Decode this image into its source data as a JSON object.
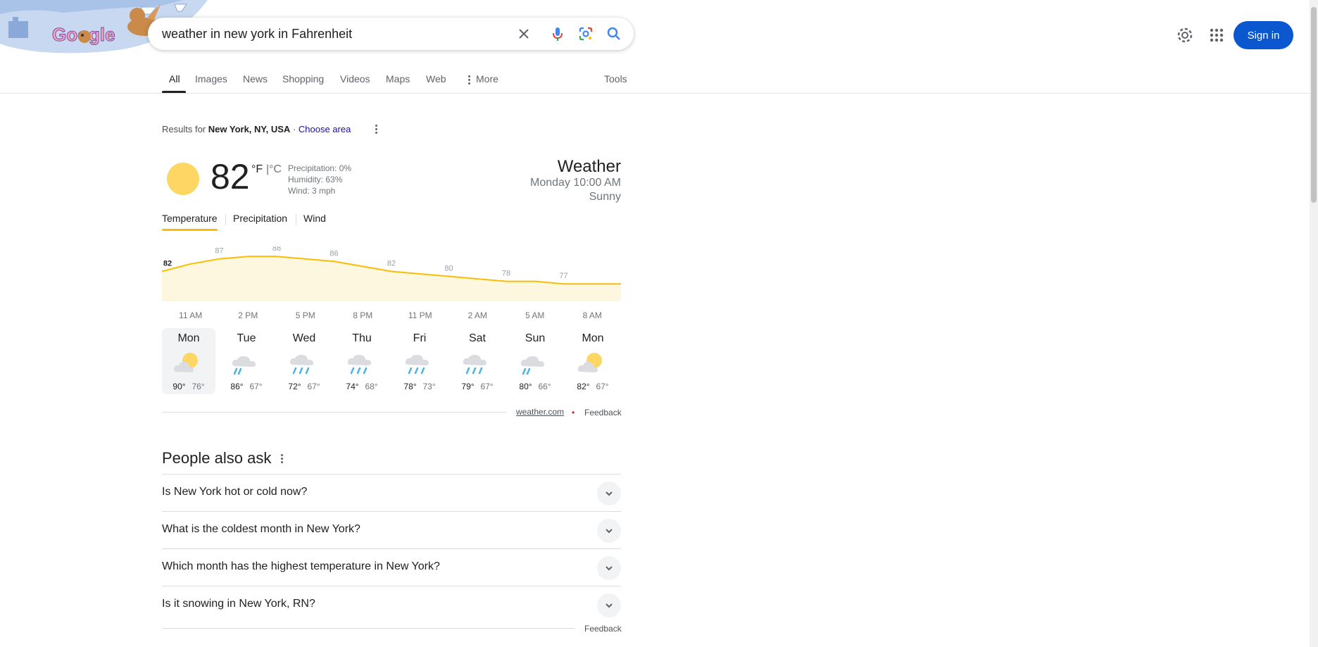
{
  "search": {
    "query": "weather in new york in Fahrenheit"
  },
  "header": {
    "sign_in": "Sign in"
  },
  "tabs": [
    {
      "label": "All"
    },
    {
      "label": "Images"
    },
    {
      "label": "News"
    },
    {
      "label": "Shopping"
    },
    {
      "label": "Videos"
    },
    {
      "label": "Maps"
    },
    {
      "label": "Web"
    },
    {
      "label": "More"
    }
  ],
  "tools": "Tools",
  "results_for": {
    "prefix": "Results for",
    "location": "New York, NY, USA",
    "sep": " · ",
    "choose": "Choose area"
  },
  "weather": {
    "temp": "82",
    "unit_f": "°F",
    "unit_sep": "|",
    "unit_c": "°C",
    "precipitation": "Precipitation: 0%",
    "humidity": "Humidity: 63%",
    "wind": "Wind: 3 mph",
    "title": "Weather",
    "time": "Monday 10:00 AM",
    "condition": "Sunny",
    "subtabs": [
      "Temperature",
      "Precipitation",
      "Wind"
    ]
  },
  "chart_data": {
    "type": "area",
    "x": [
      "10 AM",
      "11 AM",
      "1 PM",
      "2 PM",
      "4 PM",
      "5 PM",
      "7 PM",
      "8 PM",
      "10 PM",
      "11 PM",
      "1 AM",
      "2 AM",
      "4 AM",
      "5 AM",
      "7 AM",
      "8 AM",
      "9 AM"
    ],
    "values": [
      82,
      85,
      87,
      88,
      88,
      87,
      86,
      84,
      82,
      81,
      80,
      79,
      78,
      78,
      77,
      77,
      77
    ],
    "labels": [
      {
        "x": "10 AM",
        "value": "82",
        "current": true
      },
      {
        "x": "1 PM",
        "value": "87"
      },
      {
        "x": "4 PM",
        "value": "88"
      },
      {
        "x": "7 PM",
        "value": "86"
      },
      {
        "x": "10 PM",
        "value": "82"
      },
      {
        "x": "1 AM",
        "value": "80"
      },
      {
        "x": "4 AM",
        "value": "78"
      },
      {
        "x": "7 AM",
        "value": "77"
      }
    ],
    "ticks": [
      "11 AM",
      "2 PM",
      "5 PM",
      "8 PM",
      "11 PM",
      "2 AM",
      "5 AM",
      "8 AM"
    ],
    "ylim": [
      70,
      92
    ],
    "color": "#fbbc04",
    "fill": "#fef7e0"
  },
  "forecast": [
    {
      "day": "Mon",
      "hi": "90°",
      "lo": "76°",
      "icon": "partly-cloudy-icon",
      "selected": true
    },
    {
      "day": "Tue",
      "hi": "86°",
      "lo": "67°",
      "icon": "scattered-showers-icon"
    },
    {
      "day": "Wed",
      "hi": "72°",
      "lo": "67°",
      "icon": "showers-icon"
    },
    {
      "day": "Thu",
      "hi": "74°",
      "lo": "68°",
      "icon": "showers-icon"
    },
    {
      "day": "Fri",
      "hi": "78°",
      "lo": "73°",
      "icon": "showers-icon"
    },
    {
      "day": "Sat",
      "hi": "79°",
      "lo": "67°",
      "icon": "showers-icon"
    },
    {
      "day": "Sun",
      "hi": "80°",
      "lo": "66°",
      "icon": "scattered-showers-icon"
    },
    {
      "day": "Mon",
      "hi": "82°",
      "lo": "67°",
      "icon": "partly-cloudy-icon"
    }
  ],
  "source": {
    "link": "weather.com",
    "feedback": "Feedback"
  },
  "paa": {
    "title": "People also ask",
    "questions": [
      "Is New York hot or cold now?",
      "What is the coldest month in New York?",
      "Which month has the highest temperature in New York?",
      "Is it snowing in New York, RN?"
    ],
    "feedback": "Feedback"
  },
  "colors": {
    "accent": "#0b57d0",
    "sun": "#fdd663",
    "chart_line": "#fbbc04"
  }
}
